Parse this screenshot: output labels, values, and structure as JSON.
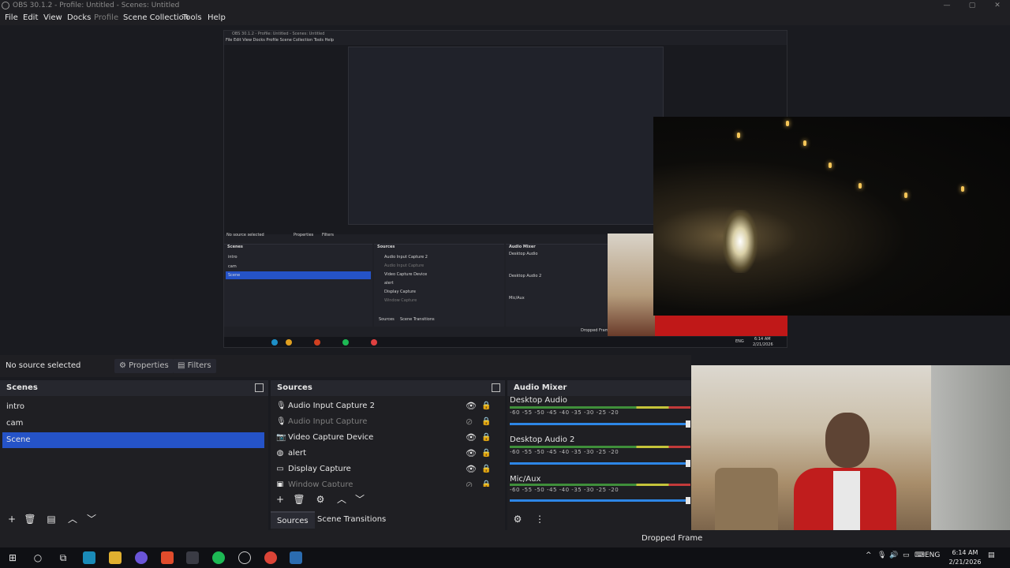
{
  "window": {
    "title": "OBS 30.1.2 - Profile: Untitled - Scenes: Untitled",
    "minimize": "—",
    "maximize": "▢",
    "close": "✕"
  },
  "menu": [
    "File",
    "Edit",
    "View",
    "Docks",
    "Profile",
    "Scene Collection",
    "Tools",
    "Help"
  ],
  "preview": {
    "nested_title": "OBS 30.1.2 - Profile: Untitled - Scenes: Untitled",
    "nested_menu": "File  Edit  View  Docks  Profile  Scene Collection  Tools  Help",
    "nested_no_source": "No source selected",
    "nested_properties": "Properties",
    "nested_filters": "Filters",
    "nested_scenes_header": "Scenes",
    "nested_sources_header": "Sources",
    "nested_mixer_header": "Audio Mixer",
    "nested_scenes": [
      "intro",
      "cam",
      "Scene"
    ],
    "nested_sources": [
      "Audio Input Capture 2",
      "Audio Input Capture",
      "Video Capture Device",
      "alert",
      "Display Capture",
      "Window Capture"
    ],
    "nested_mixer": [
      "Desktop Audio",
      "Desktop Audio 2",
      "Mic/Aux"
    ],
    "nested_tabs": [
      "Sources",
      "Scene Transitions"
    ],
    "nested_dropped": "Dropped Frame",
    "nested_clock_time": "6:14 AM",
    "nested_clock_date": "2/21/2026",
    "nested_lang": "ENG"
  },
  "controls": {
    "no_source": "No source selected",
    "properties": "Properties",
    "filters": "Filters"
  },
  "scenes": {
    "header": "Scenes",
    "items": [
      {
        "label": "intro",
        "selected": false
      },
      {
        "label": "cam",
        "selected": false
      },
      {
        "label": "Scene",
        "selected": true
      }
    ]
  },
  "sources": {
    "header": "Sources",
    "items": [
      {
        "label": "Audio Input Capture 2",
        "icon": "microphone-icon",
        "visible": true
      },
      {
        "label": "Audio Input Capture",
        "icon": "microphone-icon",
        "visible": false
      },
      {
        "label": "Video Capture Device",
        "icon": "camera-icon",
        "visible": true
      },
      {
        "label": "alert",
        "icon": "globe-icon",
        "visible": true
      },
      {
        "label": "Display Capture",
        "icon": "monitor-icon",
        "visible": true
      },
      {
        "label": "Window Capture",
        "icon": "window-icon",
        "visible": false
      }
    ]
  },
  "tabs": [
    "Sources",
    "Scene Transitions"
  ],
  "mixer": {
    "header": "Audio Mixer",
    "scale": "-60  -55  -50  -45  -40  -35  -30  -25  -20",
    "channels": [
      {
        "name": "Desktop Audio",
        "volume": 1.0
      },
      {
        "name": "Desktop Audio 2",
        "volume": 1.0
      },
      {
        "name": "Mic/Aux",
        "volume": 1.0
      }
    ]
  },
  "status": {
    "dropped": "Dropped Frame"
  },
  "taskbar": {
    "lang": "ENG",
    "time": "6:14 AM",
    "date": "2/21/2026",
    "tray_arrow": "^"
  },
  "colors": {
    "selection": "#2553c7",
    "background": "#1f1f23",
    "meter_green": "#3f8f3a",
    "slider_blue": "#2d86e6"
  }
}
